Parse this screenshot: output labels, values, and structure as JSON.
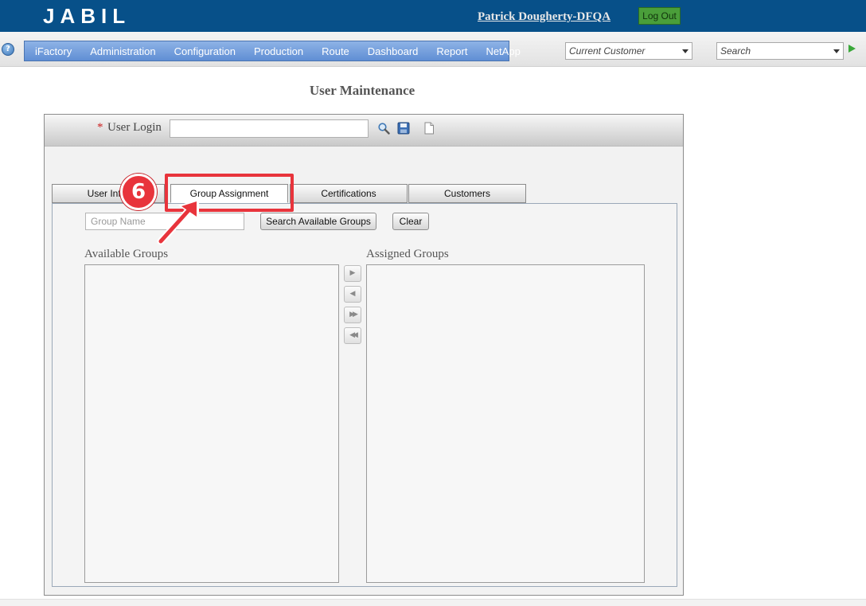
{
  "header": {
    "logo": "JABIL",
    "user": "Patrick Dougherty-DFQA",
    "logout": "Log Out"
  },
  "nav": {
    "items": [
      "iFactory",
      "Administration",
      "Configuration",
      "Production",
      "Route",
      "Dashboard",
      "Report",
      "NetApp"
    ],
    "customer_select": "Current Customer",
    "search_select": "Search"
  },
  "page": {
    "title": "User Maintenance"
  },
  "form": {
    "required_mark": "*",
    "user_login_label": "User Login",
    "user_login_value": ""
  },
  "tabs": [
    "User Infor",
    "Group Assignment",
    "Certifications",
    "Customers"
  ],
  "group_assignment": {
    "group_name_placeholder": "Group Name",
    "search_button": "Search Available Groups",
    "clear_button": "Clear",
    "available_label": "Available Groups",
    "assigned_label": "Assigned Groups"
  },
  "annotation": {
    "step": "6"
  },
  "colors": {
    "header_bg": "#075089",
    "menu_bg": "#6f9cdc",
    "logout_bg": "#4a9e3a",
    "annotation_red": "#e8343c"
  }
}
